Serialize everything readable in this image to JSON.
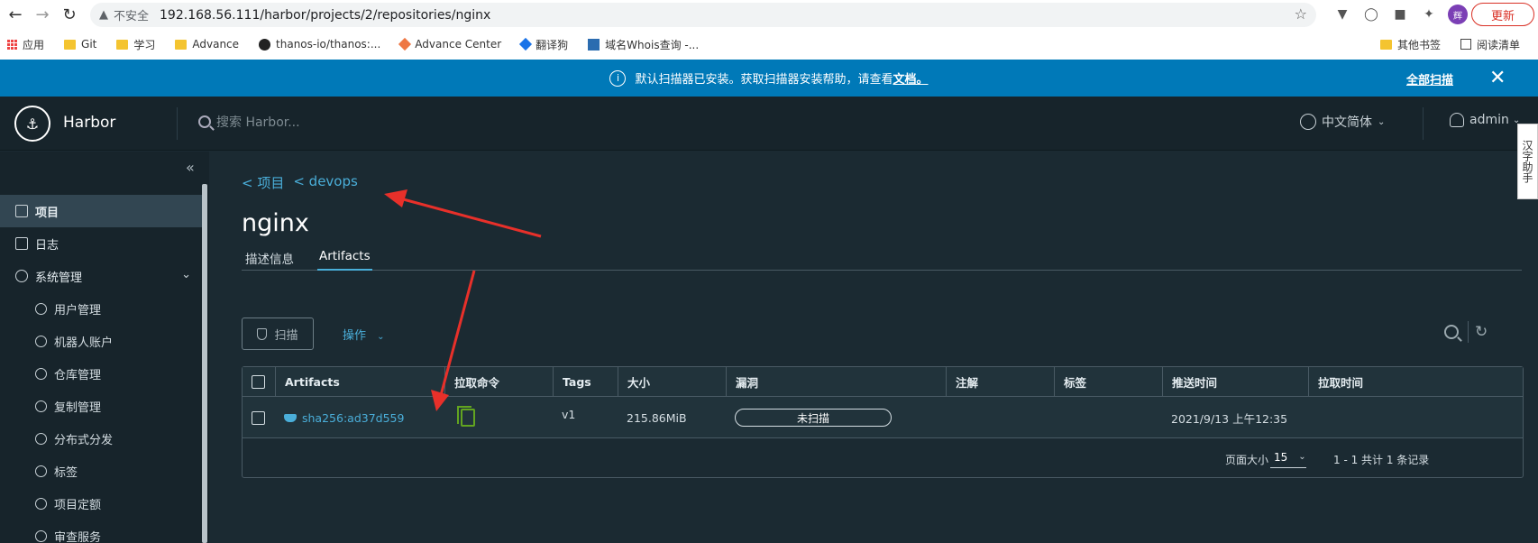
{
  "browser": {
    "insecure_label": "不安全",
    "url": "192.168.56.111/harbor/projects/2/repositories/nginx",
    "avatar_text": "辉",
    "update_label": "更新",
    "bookmarks": [
      "应用",
      "Git",
      "学习",
      "Advance",
      "thanos-io/thanos:...",
      "Advance Center",
      "翻译狗",
      "域名Whois查询 -..."
    ],
    "bookmarks_right": [
      "其他书签",
      "阅读清单"
    ]
  },
  "banner": {
    "message": "默认扫描器已安装。获取扫描器安装帮助，请查看",
    "link": "文档。",
    "scan_all": "全部扫描"
  },
  "header": {
    "brand": "Harbor",
    "search_placeholder": "搜索 Harbor...",
    "language": "中文简体",
    "user": "admin"
  },
  "side_tab_label": "汉字助手",
  "sidebar": {
    "items": [
      {
        "label": "项目",
        "active": true
      },
      {
        "label": "日志"
      },
      {
        "label": "系统管理"
      }
    ],
    "sub_items": [
      "用户管理",
      "机器人账户",
      "仓库管理",
      "复制管理",
      "分布式分发",
      "标签",
      "项目定额",
      "审查服务"
    ]
  },
  "breadcrumb": [
    "< 项目",
    "< devops"
  ],
  "page_title": "nginx",
  "tabs": [
    "描述信息",
    "Artifacts"
  ],
  "toolbar": {
    "scan_label": "扫描",
    "ops_label": "操作"
  },
  "grid": {
    "columns": [
      "Artifacts",
      "拉取命令",
      "Tags",
      "大小",
      "漏洞",
      "注解",
      "标签",
      "推送时间",
      "拉取时间"
    ],
    "rows": [
      {
        "digest": "sha256:ad37d559",
        "tags": "v1",
        "size": "215.86MiB",
        "vulnerability": "未扫描",
        "annotation": "",
        "labels": "",
        "push_time": "2021/9/13 上午12:35",
        "pull_time": ""
      }
    ],
    "page_size_label": "页面大小",
    "page_size": "15",
    "total": "1 - 1 共计 1 条记录"
  },
  "colors": {
    "banner": "#0079b8",
    "header": "#17242b",
    "content": "#1b2a32",
    "link": "#4aaed9",
    "copy_icon": "#62a420",
    "annotation_arrow": "#e8302a"
  }
}
